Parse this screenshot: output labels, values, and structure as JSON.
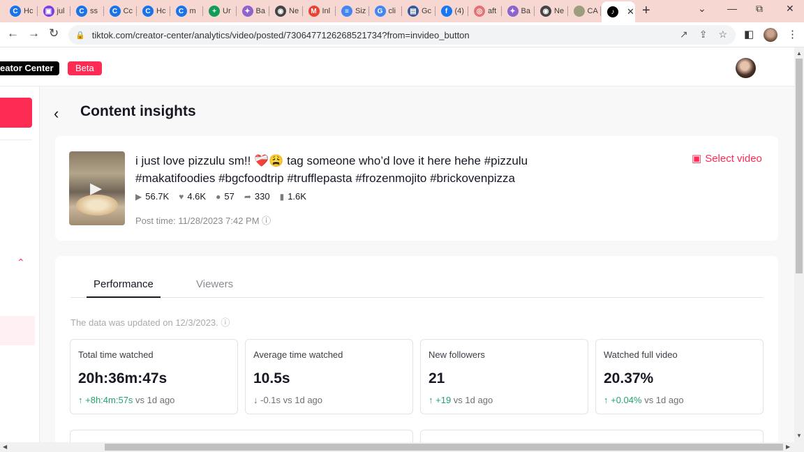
{
  "browser": {
    "tabs": [
      {
        "label": "Hc",
        "color": "#1a73e8",
        "glyph": "C"
      },
      {
        "label": "jul",
        "color": "#7b3fe4",
        "glyph": "▣"
      },
      {
        "label": "ss",
        "color": "#1a73e8",
        "glyph": "C"
      },
      {
        "label": "Cc",
        "color": "#1a73e8",
        "glyph": "C"
      },
      {
        "label": "Hc",
        "color": "#1a73e8",
        "glyph": "C"
      },
      {
        "label": "m",
        "color": "#1a73e8",
        "glyph": "C"
      },
      {
        "label": "Ur",
        "color": "#0f9d58",
        "glyph": "+"
      },
      {
        "label": "Ba",
        "color": "#8e63ce",
        "glyph": "✦"
      },
      {
        "label": "Ne",
        "color": "#444444",
        "glyph": "◉"
      },
      {
        "label": "Inl",
        "color": "#ea4335",
        "glyph": "M"
      },
      {
        "label": "Siz",
        "color": "#4285f4",
        "glyph": "≡"
      },
      {
        "label": "cli",
        "color": "#4285f4",
        "glyph": "G"
      },
      {
        "label": "Gc",
        "color": "#3c5a99",
        "glyph": "▤"
      },
      {
        "label": "(4)",
        "color": "#1877f2",
        "glyph": "f"
      },
      {
        "label": "aft",
        "color": "#e57373",
        "glyph": "◎"
      },
      {
        "label": "Ba",
        "color": "#8e63ce",
        "glyph": "✦"
      },
      {
        "label": "Ne",
        "color": "#444444",
        "glyph": "◉"
      },
      {
        "label": "CA",
        "color": "#9e9e7e",
        "glyph": ""
      }
    ],
    "active_tab_glyph": "♪",
    "close_glyph": "✕",
    "new_tab_glyph": "+",
    "window_controls": [
      "⌄",
      "—",
      "⧉",
      "✕"
    ],
    "url": "tiktok.com/creator-center/analytics/video/posted/7306477126268521734?from=invideo_button",
    "lock_glyph": "🔒",
    "nav": {
      "back": "←",
      "forward": "→",
      "reload": "↻"
    },
    "omnibox_icons": [
      "↗",
      "⇪",
      "☆"
    ],
    "sidepanel_glyph": "◧",
    "menu_glyph": "⋮"
  },
  "header": {
    "brand": "eator Center",
    "beta": "Beta"
  },
  "sidebar": {
    "collapse_glyph": "⌃"
  },
  "main": {
    "back_glyph": "‹",
    "title": "Content insights"
  },
  "video": {
    "caption": "i just love pizzulu sm!! ❤️‍🩹😩 tag someone who’d love it here hehe #pizzulu #makatifoodies #bgcfoodtrip #trufflepasta #frozenmojito #brickovenpizza",
    "play_glyph": "▶",
    "stats": [
      {
        "icon": "play-icon",
        "glyph": "▶",
        "value": "56.7K"
      },
      {
        "icon": "heart-icon",
        "glyph": "♥",
        "value": "4.6K"
      },
      {
        "icon": "comment-icon",
        "glyph": "●",
        "value": "57"
      },
      {
        "icon": "share-icon",
        "glyph": "➦",
        "value": "330"
      },
      {
        "icon": "bookmark-icon",
        "glyph": "▮",
        "value": "1.6K"
      }
    ],
    "post_time": "Post time: 11/28/2023 7:42 PM ⓘ",
    "select_video": "Select video",
    "select_video_glyph": "▣"
  },
  "performance": {
    "tabs": [
      "Performance",
      "Viewers"
    ],
    "updated": "The data was updated on 12/3/2023. ⓘ",
    "metrics": [
      {
        "label": "Total time watched",
        "value": "20h:36m:47s",
        "arrow": "↑",
        "change": "+8h:4m:57s",
        "suffix": " vs 1d ago",
        "trend": "up"
      },
      {
        "label": "Average time watched",
        "value": "10.5s",
        "arrow": "↓",
        "change": "-0.1s",
        "suffix": " vs 1d ago",
        "trend": "down"
      },
      {
        "label": "New followers",
        "value": "21",
        "arrow": "↑",
        "change": "+19",
        "suffix": " vs 1d ago",
        "trend": "up"
      },
      {
        "label": "Watched full video",
        "value": "20.37%",
        "arrow": "↑",
        "change": "+0.04%",
        "suffix": " vs 1d ago",
        "trend": "up"
      }
    ]
  },
  "scroll": {
    "up": "▲",
    "down": "▼",
    "left": "◀",
    "right": "▶"
  },
  "colors": {
    "accent": "#fe2c55",
    "positive": "#20a46e",
    "tabbar": "#f7d7d1"
  }
}
